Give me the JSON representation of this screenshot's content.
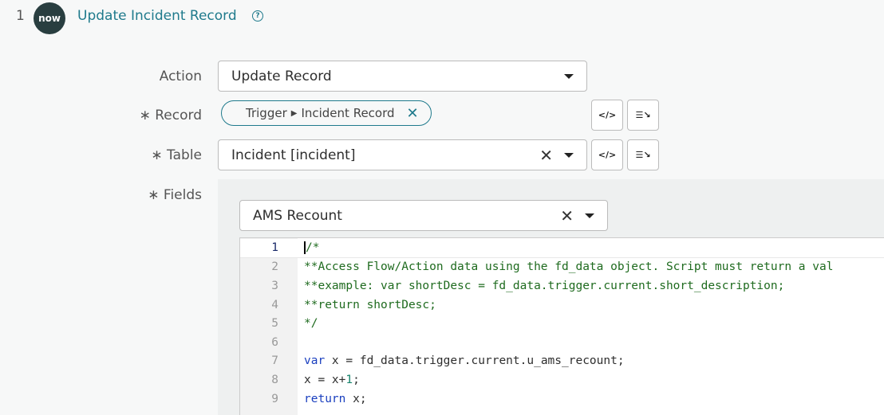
{
  "step": {
    "number": "1",
    "logo_text": "now",
    "title": "Update Incident Record",
    "help_icon": "question-circle-icon"
  },
  "action": {
    "label": "Action",
    "value": "Update Record"
  },
  "record": {
    "label": "∗ Record",
    "pill_parts": [
      "Trigger",
      "Incident Record"
    ]
  },
  "table": {
    "label": "∗ Table",
    "value": "Incident [incident]"
  },
  "fields": {
    "label": "∗ Fields",
    "field_select": "AMS Recount"
  },
  "buttons": {
    "script_icon": "script-toggle-icon",
    "picker_icon": "data-pill-picker-icon"
  },
  "editor": {
    "lines": [
      {
        "n": "1",
        "t": "/*",
        "c": "cmt"
      },
      {
        "n": "2",
        "t": "**Access Flow/Action data using the fd_data object. Script must return a val",
        "c": "cmt"
      },
      {
        "n": "3",
        "t": "**example: var shortDesc = fd_data.trigger.current.short_description;",
        "c": "cmt"
      },
      {
        "n": "4",
        "t": "**return shortDesc;",
        "c": "cmt"
      },
      {
        "n": "5",
        "t": "*/",
        "c": "cmt"
      },
      {
        "n": "6",
        "t": "",
        "c": ""
      },
      {
        "n": "7",
        "parts": [
          {
            "t": "var",
            "c": "kw"
          },
          {
            "t": " x = fd_data.trigger.current.u_ams_recount;",
            "c": ""
          }
        ]
      },
      {
        "n": "8",
        "parts": [
          {
            "t": "x = x+",
            "c": ""
          },
          {
            "t": "1",
            "c": "num"
          },
          {
            "t": ";",
            "c": ""
          }
        ]
      },
      {
        "n": "9",
        "parts": [
          {
            "t": "return",
            "c": "kw"
          },
          {
            "t": " x;",
            "c": ""
          }
        ]
      }
    ]
  },
  "colors": {
    "accent": "#1f7a8c",
    "logo_bg": "#293e40",
    "comment": "#1f6b1f",
    "keyword": "#1a3fbf"
  }
}
